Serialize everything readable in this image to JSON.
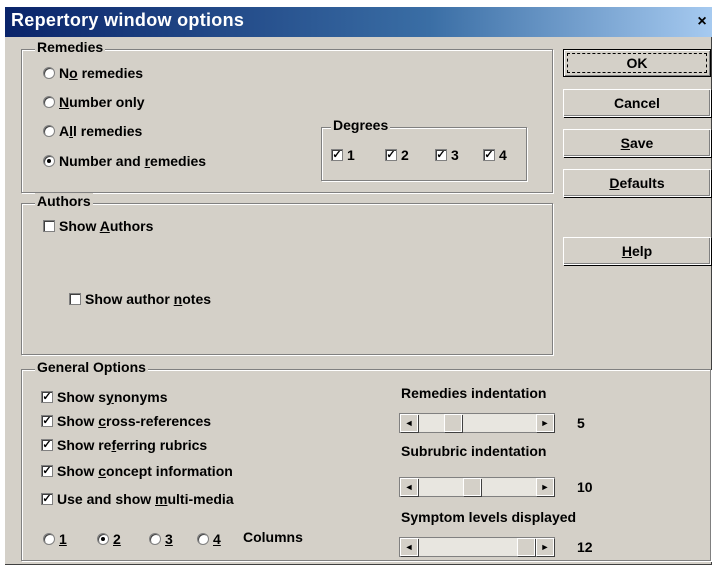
{
  "window": {
    "title": "Repertory window options",
    "close_symbol": "×"
  },
  "remedies": {
    "label": "Remedies",
    "options": [
      {
        "pre": "N",
        "key": "o",
        "post": " remedies",
        "checked": false
      },
      {
        "pre": "",
        "key": "N",
        "post": "umber only",
        "checked": false
      },
      {
        "pre": "A",
        "key": "l",
        "post": "l remedies",
        "checked": false
      },
      {
        "pre": "Number and ",
        "key": "r",
        "post": "emedies",
        "checked": true
      }
    ]
  },
  "degrees": {
    "label": "Degrees",
    "items": [
      {
        "label": "1",
        "checked": true
      },
      {
        "label": "2",
        "checked": true
      },
      {
        "label": "3",
        "checked": true
      },
      {
        "label": "4",
        "checked": true
      }
    ]
  },
  "authors": {
    "label": "Authors",
    "show_authors": {
      "pre": "Show ",
      "key": "A",
      "post": "uthors",
      "checked": false
    },
    "show_author_notes": {
      "pre": "Show author ",
      "key": "n",
      "post": "otes",
      "checked": false
    }
  },
  "buttons": {
    "ok": "OK",
    "cancel": "Cancel",
    "save": {
      "key": "S",
      "post": "ave"
    },
    "defaults": {
      "key": "D",
      "post": "efaults"
    },
    "help": {
      "key": "H",
      "post": "elp"
    }
  },
  "general": {
    "label": "General Options",
    "checks": [
      {
        "pre": "Show s",
        "key": "y",
        "post": "nonyms",
        "checked": true
      },
      {
        "pre": "Show ",
        "key": "c",
        "post": "ross-references",
        "checked": true
      },
      {
        "pre": "Show re",
        "key": "f",
        "post": "erring rubrics",
        "checked": true
      },
      {
        "pre": "Show ",
        "key": "c",
        "post": "oncept information",
        "checked": true
      },
      {
        "pre": "Use and show ",
        "key": "m",
        "post": "ulti-media",
        "checked": true
      }
    ],
    "columns": {
      "label": "Columns",
      "options": [
        {
          "label": "1",
          "checked": false
        },
        {
          "label": "2",
          "checked": true
        },
        {
          "label": "3",
          "checked": false
        },
        {
          "label": "4",
          "checked": false
        }
      ]
    },
    "remedies_indentation": {
      "label": "Remedies indentation",
      "value": "5",
      "position": 0.25
    },
    "subrubric_indentation": {
      "label": "Subrubric indentation",
      "value": "10",
      "position": 0.45
    },
    "symptom_levels": {
      "label": "Symptom levels displayed",
      "value": "12",
      "position": 1.0
    }
  },
  "icons": {
    "arrow_left": "◄",
    "arrow_right": "►",
    "check": "✓"
  }
}
